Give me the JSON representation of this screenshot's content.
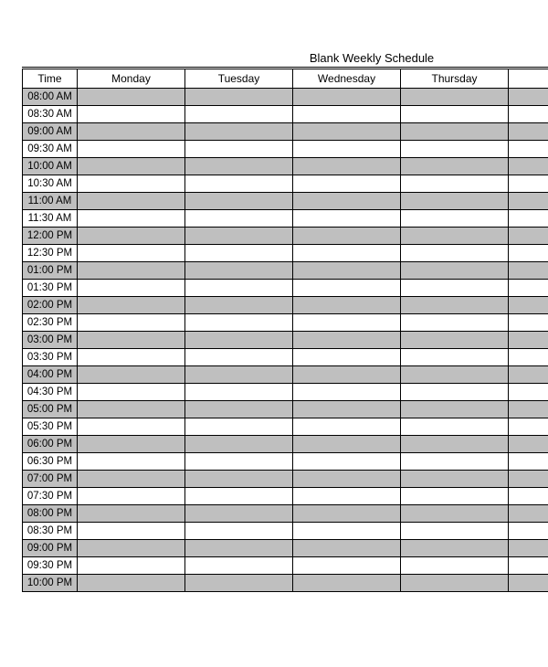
{
  "title": "Blank Weekly Schedule",
  "header": {
    "time": "Time",
    "days": [
      "Monday",
      "Tuesday",
      "Wednesday",
      "Thursday"
    ]
  },
  "rows": [
    {
      "time": "08:00 AM",
      "shaded": true
    },
    {
      "time": "08:30 AM",
      "shaded": false
    },
    {
      "time": "09:00 AM",
      "shaded": true
    },
    {
      "time": "09:30 AM",
      "shaded": false
    },
    {
      "time": "10:00 AM",
      "shaded": true
    },
    {
      "time": "10:30 AM",
      "shaded": false
    },
    {
      "time": "11:00 AM",
      "shaded": true
    },
    {
      "time": "11:30 AM",
      "shaded": false
    },
    {
      "time": "12:00 PM",
      "shaded": true
    },
    {
      "time": "12:30 PM",
      "shaded": false
    },
    {
      "time": "01:00 PM",
      "shaded": true
    },
    {
      "time": "01:30 PM",
      "shaded": false
    },
    {
      "time": "02:00 PM",
      "shaded": true
    },
    {
      "time": "02:30 PM",
      "shaded": false
    },
    {
      "time": "03:00 PM",
      "shaded": true
    },
    {
      "time": "03:30 PM",
      "shaded": false
    },
    {
      "time": "04:00 PM",
      "shaded": true
    },
    {
      "time": "04:30 PM",
      "shaded": false
    },
    {
      "time": "05:00 PM",
      "shaded": true
    },
    {
      "time": "05:30 PM",
      "shaded": false
    },
    {
      "time": "06:00 PM",
      "shaded": true
    },
    {
      "time": "06:30 PM",
      "shaded": false
    },
    {
      "time": "07:00 PM",
      "shaded": true
    },
    {
      "time": "07:30 PM",
      "shaded": false
    },
    {
      "time": "08:00 PM",
      "shaded": true
    },
    {
      "time": "08:30 PM",
      "shaded": false
    },
    {
      "time": "09:00 PM",
      "shaded": true
    },
    {
      "time": "09:30 PM",
      "shaded": false
    },
    {
      "time": "10:00 PM",
      "shaded": true
    }
  ]
}
